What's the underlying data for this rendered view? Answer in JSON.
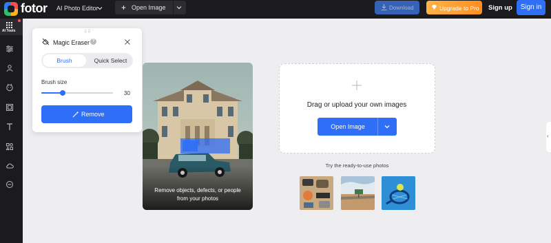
{
  "header": {
    "logo_text": "fotor",
    "editor_select": "AI Photo Editor",
    "open_image_label": "Open Image",
    "download_label": "Download",
    "upgrade_label": "Upgrade to Pro",
    "signup_label": "Sign up",
    "signin_label": "Sign in"
  },
  "sidebar": {
    "active_label": "AI Tools",
    "icons": [
      "sliders-icon",
      "person-icon",
      "face-icon",
      "frame-icon",
      "text-icon",
      "elements-icon",
      "cloud-icon",
      "more-icon"
    ]
  },
  "panel": {
    "title": "Magic Eraser",
    "modes": [
      "Brush",
      "Quick Select"
    ],
    "active_mode": "Brush",
    "brush_size_label": "Brush size",
    "brush_size_value": "30",
    "brush_size_fraction": 0.3,
    "remove_label": "Remove"
  },
  "sample": {
    "caption_line1": "Remove objects, defects, or people",
    "caption_line2": "from your photos"
  },
  "upload": {
    "prompt": "Drag or upload your own images",
    "button_label": "Open Image",
    "try_label": "Try the ready-to-use photos"
  },
  "colors": {
    "accent": "#2f6ef6",
    "topbar": "#1b1b1e",
    "upgrade": "#ff9f2e"
  }
}
